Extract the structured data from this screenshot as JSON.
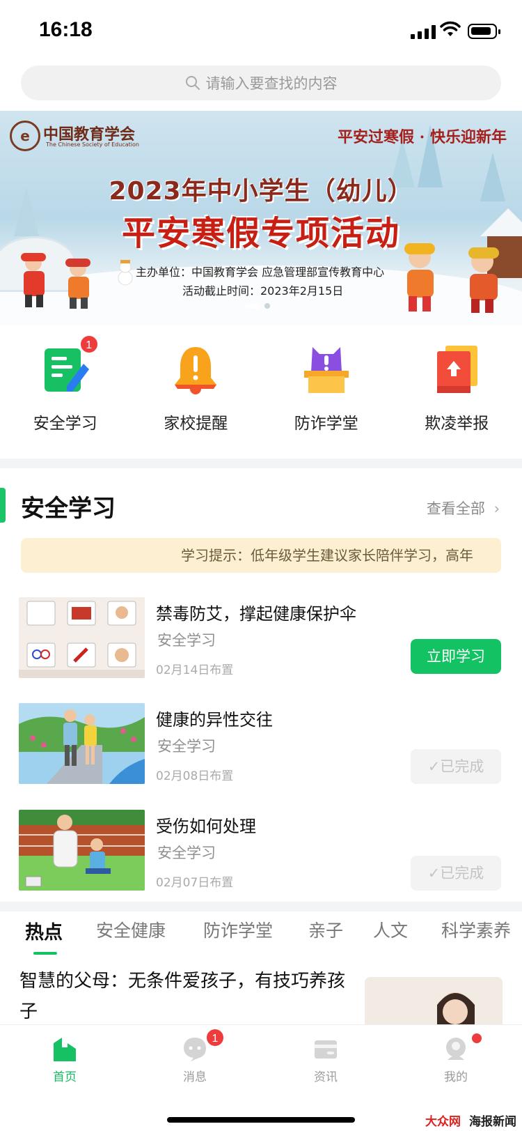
{
  "status_bar": {
    "time": "16:18"
  },
  "search": {
    "placeholder": "请输入要查找的内容"
  },
  "banner": {
    "logo_cn": "中国教育学会",
    "logo_en": "The Chinese Society of Education",
    "slogan": "平安过寒假 · 快乐迎新年",
    "title_line1": "2023年中小学生（幼儿）",
    "title_line2": "平安寒假专项活动",
    "host": "主办单位：中国教育学会 应急管理部宣传教育中心",
    "deadline": "活动截止时间：2023年2月15日"
  },
  "quick_menu": [
    {
      "label": "安全学习",
      "icon": "study-notepad-icon",
      "badge": "1"
    },
    {
      "label": "家校提醒",
      "icon": "bell-alert-icon"
    },
    {
      "label": "防诈学堂",
      "icon": "anti-fraud-box-icon"
    },
    {
      "label": "欺凌举报",
      "icon": "report-upload-icon"
    }
  ],
  "section": {
    "title": "安全学习",
    "more": "查看全部",
    "tip": "学习提示：低年级学生建议家长陪伴学习，高年"
  },
  "courses": [
    {
      "title": "禁毒防艾，撑起健康保护伞",
      "category": "安全学习",
      "date": "02月14日布置",
      "action": "立即学习"
    },
    {
      "title": "健康的异性交往",
      "category": "安全学习",
      "date": "02月08日布置",
      "action": "已完成"
    },
    {
      "title": "受伤如何处理",
      "category": "安全学习",
      "date": "02月07日布置",
      "action": "已完成"
    }
  ],
  "tabs": [
    "热点",
    "安全健康",
    "防诈学堂",
    "亲子",
    "人文",
    "科学素养"
  ],
  "article": {
    "title": "智慧的父母：无条件爱孩子，有技巧养孩子"
  },
  "bottom_nav": [
    {
      "label": "首页",
      "icon": "home-icon"
    },
    {
      "label": "消息",
      "icon": "message-icon",
      "badge": "1"
    },
    {
      "label": "资讯",
      "icon": "news-icon"
    },
    {
      "label": "我的",
      "icon": "profile-icon"
    }
  ],
  "watermark": {
    "left": "大众网",
    "right": "海报新闻"
  },
  "colors": {
    "accent": "#13c262",
    "badge": "#ee3b3b",
    "tip_bg": "#fcefd2"
  }
}
